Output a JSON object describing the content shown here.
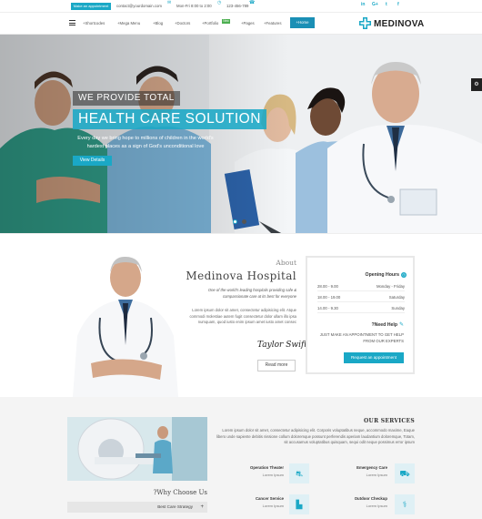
{
  "topbar": {
    "appointment_label": "Make an appointment",
    "email": "contact@yourdomain.com",
    "hours": "Mon-Fri 8:00 to 2:00",
    "phone": "123-456-789",
    "social": [
      "in",
      "G+",
      "t",
      "f"
    ]
  },
  "nav": {
    "items": [
      "Shortcodes",
      "Mega Menu",
      "Blog",
      "Doctors",
      "Portfolio",
      "Pages",
      "Features",
      "Home"
    ],
    "new_badge": "New",
    "logo": "MEDINOVA"
  },
  "hero": {
    "tagline": "WE PROVIDE TOTAL",
    "title": "HEALTH CARE SOLUTION",
    "description": "Every day we bring hope to millions of children in the world's hardest places as a sign of God's unconditional love",
    "button": "View Details"
  },
  "about": {
    "small": "About",
    "title": "Medinova Hospital",
    "italic": "One of the world's leading hospitals providing safe & compassionate care at its best for everyone",
    "body": "Lorem ipsum dolor sit amet, consectetur adipisicing elit. Atque commodi molestiae autem fugit consectetur dolor ullam illo ipsa numquam, quod iusto enim ipsum amet iusto amet consec",
    "signature": "Taylor Swift",
    "read_more": "Read more"
  },
  "hours": {
    "title": "Opening Hours",
    "rows": [
      {
        "time": "28.00 - 9.00",
        "day": "Monday - Friday"
      },
      {
        "time": "18.00 - 19.00",
        "day": "Saturday"
      },
      {
        "time": "14.00 - 9.30",
        "day": "Sunday"
      }
    ],
    "need_help": "?Need Help",
    "help_text": "JUST MAKE AN APPOINTMENT TO GET HELP FROM OUR EXPERTS",
    "request": "Request an appointment"
  },
  "services": {
    "why_title": "?Why Choose Us",
    "strategy": "Best Care Strategy",
    "heading": "OUR SERVICES",
    "intro": "Lorem ipsum dolor sit amet, consectetur adipisicing elit. Corporis voluptatibus neque, accommodo maxime, Eaque libero unde sapiente debitis nissione collum doloremque possunt perferendis aperiam laudantium doloremque, Totam, sit accusamus voluptatibus quisquam, sequi odit neque possimus error ipsum",
    "items": [
      {
        "name": "Operation Theater",
        "sub": "Lorem Ipsum"
      },
      {
        "name": "Emergency Care",
        "sub": "Lorem Ipsum"
      },
      {
        "name": "Cancer Service",
        "sub": "Lorem Ipsum"
      },
      {
        "name": "Outdoor Checkup",
        "sub": "Lorem Ipsum"
      }
    ]
  },
  "colors": {
    "accent": "#1aa8c6",
    "nav_active": "#1a8fb5",
    "new_badge": "#4caf50"
  }
}
